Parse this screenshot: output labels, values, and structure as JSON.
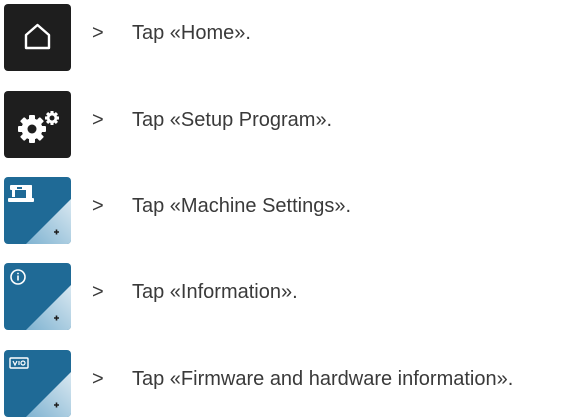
{
  "steps": [
    {
      "bullet": ">",
      "text": "Tap «Home».",
      "icon": "home-icon"
    },
    {
      "bullet": ">",
      "text": "Tap «Setup Program».",
      "icon": "gears-icon"
    },
    {
      "bullet": ">",
      "text": "Tap «Machine Settings».",
      "icon": "sewing-machine-icon"
    },
    {
      "bullet": ">",
      "text": "Tap «Information».",
      "icon": "info-icon"
    },
    {
      "bullet": ">",
      "text": "Tap «Firmware and hardware information».",
      "icon": "version-icon"
    }
  ],
  "colors": {
    "dark_button": "#1e1e1e",
    "blue_button": "#1f6a96",
    "text": "#3a3a3a"
  }
}
